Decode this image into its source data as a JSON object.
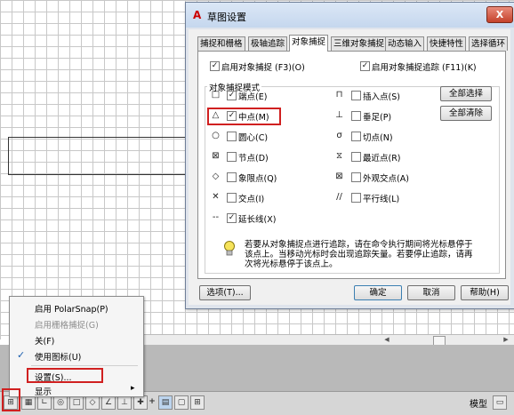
{
  "dialog": {
    "title": "草图设置",
    "close_label": "X",
    "tabs": [
      "捕捉和栅格",
      "极轴追踪",
      "对象捕捉",
      "三维对象捕捉",
      "动态输入",
      "快捷特性",
      "选择循环"
    ],
    "active_tab": "对象捕捉",
    "enable_osnap": {
      "label": "启用对象捕捉 (F3)(O)",
      "checked": true
    },
    "enable_tracking": {
      "label": "启用对象捕捉追踪 (F11)(K)",
      "checked": true
    },
    "group_title": "对象捕捉模式",
    "modes_left": [
      {
        "symbol": "□",
        "label": "端点(E)",
        "checked": true
      },
      {
        "symbol": "△",
        "label": "中点(M)",
        "checked": true
      },
      {
        "symbol": "○",
        "label": "圆心(C)",
        "checked": false
      },
      {
        "symbol": "⊠",
        "label": "节点(D)",
        "checked": false
      },
      {
        "symbol": "◇",
        "label": "象限点(Q)",
        "checked": false
      },
      {
        "symbol": "✕",
        "label": "交点(I)",
        "checked": false
      },
      {
        "symbol": "--",
        "label": "延长线(X)",
        "checked": true
      }
    ],
    "modes_right": [
      {
        "symbol": "⊓",
        "label": "插入点(S)",
        "checked": false
      },
      {
        "symbol": "⊥",
        "label": "垂足(P)",
        "checked": false
      },
      {
        "symbol": "σ",
        "label": "切点(N)",
        "checked": false
      },
      {
        "symbol": "⧖",
        "label": "最近点(R)",
        "checked": false
      },
      {
        "symbol": "⊠",
        "label": "外观交点(A)",
        "checked": false
      },
      {
        "symbol": "//",
        "label": "平行线(L)",
        "checked": false
      }
    ],
    "select_all_label": "全部选择",
    "clear_all_label": "全部清除",
    "tip_lines": [
      "若要从对象捕捉点进行追踪，请在命令执行期间将光标悬停于",
      "该点上。当移动光标时会出现追踪矢量。若要停止追踪，请再",
      "次将光标悬停于该点上。"
    ],
    "options_label": "选项(T)...",
    "ok_label": "确定",
    "cancel_label": "取消",
    "help_label": "帮助(H)"
  },
  "context_menu": {
    "items": [
      {
        "label": "启用 PolarSnap(P)",
        "disabled": false,
        "checked": false
      },
      {
        "label": "启用栅格捕捉(G)",
        "disabled": true,
        "checked": false
      },
      {
        "label": "关(F)",
        "disabled": false,
        "checked": false
      },
      {
        "label": "使用图标(U)",
        "disabled": false,
        "checked": true
      },
      {
        "label": "设置(S)...",
        "disabled": false,
        "checked": false
      },
      {
        "label": "显示",
        "disabled": false,
        "checked": false,
        "submenu": true
      }
    ],
    "checkmark": "✓",
    "submenu_arrow": "▸"
  },
  "statusbar": {
    "model_label": "模型",
    "plus_glyph": "+"
  },
  "colors": {
    "highlight": "#d02020",
    "dialog_title": "#c5d7ee",
    "grid": "#c8c8c8"
  }
}
